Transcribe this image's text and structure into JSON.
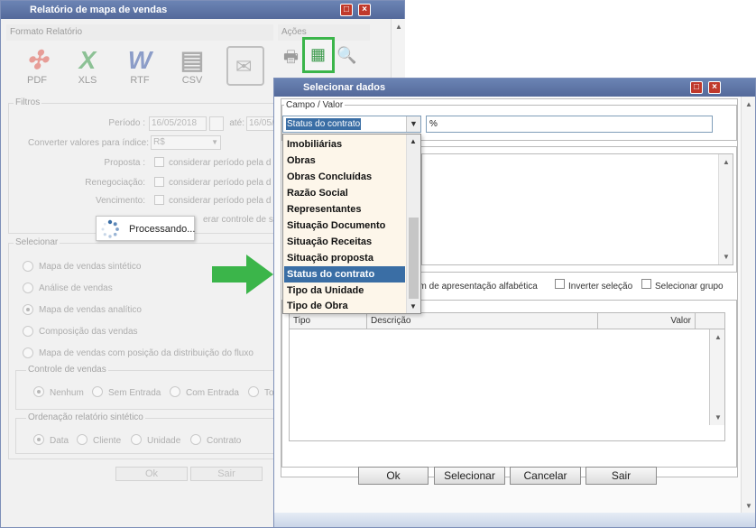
{
  "report_window": {
    "title": "Relatório de mapa de vendas",
    "format_section": {
      "title": "Formato Relatório",
      "formats": [
        {
          "label": "PDF",
          "icon": "pdf-icon",
          "color": "#e05a4e"
        },
        {
          "label": "XLS",
          "icon": "excel-icon",
          "color": "#3b9a4b"
        },
        {
          "label": "RTF",
          "icon": "word-icon",
          "color": "#3b5aa8"
        },
        {
          "label": "CSV",
          "icon": "csv-document-icon",
          "color": "#777777"
        }
      ]
    },
    "actions_section": {
      "title": "Ações"
    },
    "filters": {
      "legend": "Filtros",
      "period_label": "Período :",
      "period_start": "16/05/2018",
      "period_until": "até:",
      "period_end": "16/05/",
      "convert_label": "Converter valores para índice:",
      "convert_value": "R$",
      "proposal_label": "Proposta :",
      "renegotiation_label": "Renegociação:",
      "due_label": "Vencimento:",
      "consider_period_text": "considerar período pela d",
      "partial_text": "erar controle de sóc"
    },
    "select": {
      "legend": "Selecionar",
      "options": [
        "Mapa de vendas sintético",
        "Análise de vendas",
        "Mapa de vendas analítico",
        "Composição das vendas",
        "Mapa de vendas com posição da distribuição do fluxo"
      ],
      "selected_index": 2,
      "sales_control": {
        "legend": "Controle de vendas",
        "options": [
          "Nenhum",
          "Sem Entrada",
          "Com Entrada",
          "To"
        ],
        "selected_index": 0
      },
      "ordering": {
        "legend": "Ordenação relatório sintético",
        "options": [
          "Data",
          "Cliente",
          "Unidade",
          "Contrato"
        ],
        "selected_index": 0
      }
    },
    "ok_label": "Ok",
    "exit_label": "Sair",
    "processing_text": "Processando..."
  },
  "select_dialog": {
    "title": "Selecionar dados",
    "field_value_legend": "Campo / Valor",
    "field_selected": "Status do contrato",
    "value_text": "%",
    "alpha_order_label": "em de apresentação alfabética",
    "invert_selection_label": "Inverter seleção",
    "select_group_label": "Selecionar grupo",
    "grid_columns": [
      "Tipo",
      "Descrição",
      "Valor"
    ],
    "buttons": {
      "ok": "Ok",
      "select": "Selecionar",
      "cancel": "Cancelar",
      "exit": "Sair"
    },
    "dropdown_items": [
      "Imobiliárias",
      "Obras",
      "Obras Concluídas",
      "Razão Social",
      "Representantes",
      "Situação Documento",
      "Situação Receitas",
      "Situação proposta",
      "Status do contrato",
      "Tipo da Unidade",
      "Tipo de Obra"
    ],
    "dropdown_selected_index": 8
  },
  "colors": {
    "titlebar": "#5f77a8",
    "close_button": "#c0392b",
    "highlight_box": "#3bb54a",
    "arrow": "#3bb54a",
    "selection": "#3a6ea5",
    "dropdown_bg": "#fdf6ea"
  }
}
